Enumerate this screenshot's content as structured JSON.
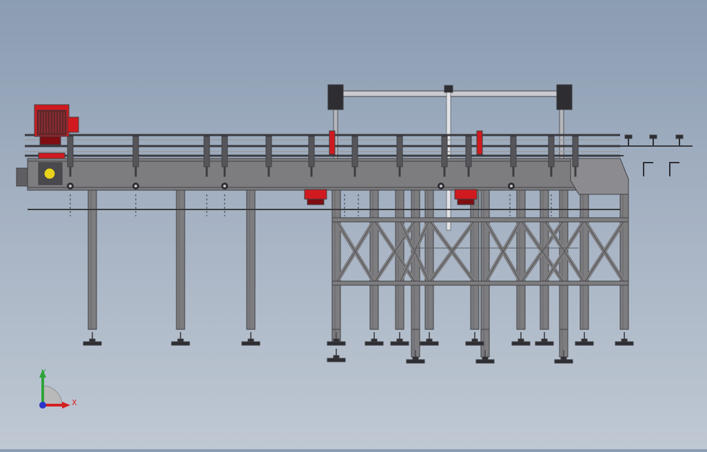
{
  "viewport": {
    "background_top": "#8b9db3",
    "background_bottom": "#bfc8d3"
  },
  "model": {
    "colors": {
      "frame": "#7d7d80",
      "frame_dark": "#3e3e42",
      "motor": "#d01a1f",
      "motor_dark": "#7e0e12",
      "accent_yellow": "#e9d21c"
    }
  },
  "triad": {
    "y_label": "Y",
    "x_label": "X",
    "y_color": "#2fa33a",
    "x_color": "#d42020",
    "z_color": "#2a35c8"
  }
}
